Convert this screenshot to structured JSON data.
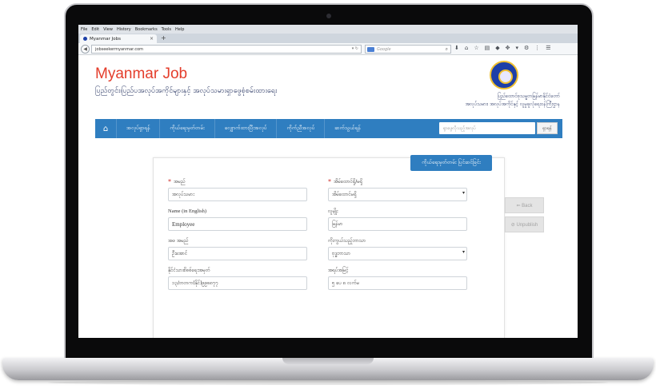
{
  "browser": {
    "menu": [
      "File",
      "Edit",
      "View",
      "History",
      "Bookmarks",
      "Tools",
      "Help"
    ],
    "tab_title": "Myanmar Jobs",
    "new_tab": "+",
    "tab_close": "×",
    "url": "jobseekermyanmar.com",
    "search_placeholder": "Google",
    "back_icon": "arrow-left-icon"
  },
  "site": {
    "brand": "Myanmar Job",
    "tagline": "ပြည်တွင်း၊ပြည်ပအလုပ်အကိုင်များနှင့် အလုပ်သမားရှာဖွေစုံစမ်းထားရေး",
    "org_line1": "ပြည်ထောင်စုသမ္မတမြန်မာနိုင်ငံတော်",
    "org_line2": "အလုပ်သမား၊ အလုပ်အကိုင်နှင့် လူမှုဖူလုံရေးဝန်ကြီးဌာန",
    "accent_color": "#2f7ec0",
    "brand_color": "#e43d2b"
  },
  "nav": {
    "home_icon": "home-icon",
    "items": [
      "အလုပ်ရှာရန်",
      "ကိုယ်ရေးမှတ်တမ်း",
      "လျှောက်ထားပြီးအလုပ်",
      "ကိုက်ညီအလုပ်",
      "ဆက်သွယ်ရန်"
    ],
    "search_placeholder": "ရှာဖွေလိုသည့်အလုပ်",
    "search_button": "ရှာရန်"
  },
  "form": {
    "badge": "ကိုယ်ရေးမှတ်တမ်း ပြင်ဆင်ခြင်း",
    "fields": [
      {
        "label": "အမည်",
        "value": "အလုပ်သမား",
        "required": true
      },
      {
        "label": "အိမ်ထောင်ရှိ/မရှိ",
        "value": "အိမ်ထောင်မရှိ",
        "required": true
      },
      {
        "label": "Name (in English)",
        "value": "Employee"
      },
      {
        "label": "လူမျိုး",
        "value": "မြန်မာ"
      },
      {
        "label": "အဖ အမည်",
        "value": "ဦးအောင်"
      },
      {
        "label": "ကိုးကွယ်သည့်ဘာသာ",
        "value": "ဗုဒ္ဓဘာသာ"
      },
      {
        "label": "နိုင်ငံသားစိစစ်ရေးအမှတ်",
        "value": "၁၃/တတက(နိုင်)၉၉၈၈၇၇"
      },
      {
        "label": "အရပ်အမြင့်",
        "value": "၅ ပေ ၈ လက်မ"
      }
    ],
    "required_mark": "*",
    "select_caret": "▾"
  },
  "side_buttons": {
    "back": "⇐ Back",
    "unpublish": "⊘ Unpublish"
  }
}
